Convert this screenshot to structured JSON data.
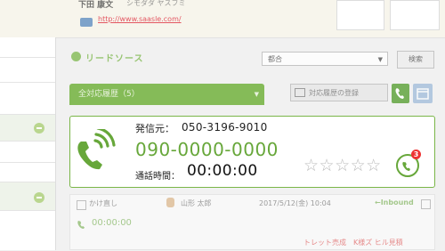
{
  "customer": {
    "name": "下田 康文",
    "name_kana": "シモダダ ヤスフミ",
    "url": "http://www.saasle.com/"
  },
  "lead_source": {
    "title": "リードソース",
    "select_value": "都合",
    "search_label": "検索"
  },
  "tabs": {
    "history_label": "全対応履歴（5）",
    "edit_label": "対応履歴の登録"
  },
  "call": {
    "caller_label": "発信元：",
    "caller_number": "050-3196-9010",
    "incoming_number": "090-0000-0000",
    "duration_label": "通話時間：",
    "duration": "00:00:00",
    "rating_stars": "☆☆☆☆☆",
    "rating": 0,
    "rating_max": 5,
    "badge": "3"
  },
  "history": {
    "callback_label": "かけ直し",
    "person": "山形 太郎",
    "date": "2017/5/12(金) 10:04",
    "direction": "←Inbound",
    "time": "00:00:00",
    "note": "トレット売成　K様ズ ヒル見積"
  },
  "colors": {
    "accent_green": "#7ab648",
    "badge_red": "#e33333"
  }
}
